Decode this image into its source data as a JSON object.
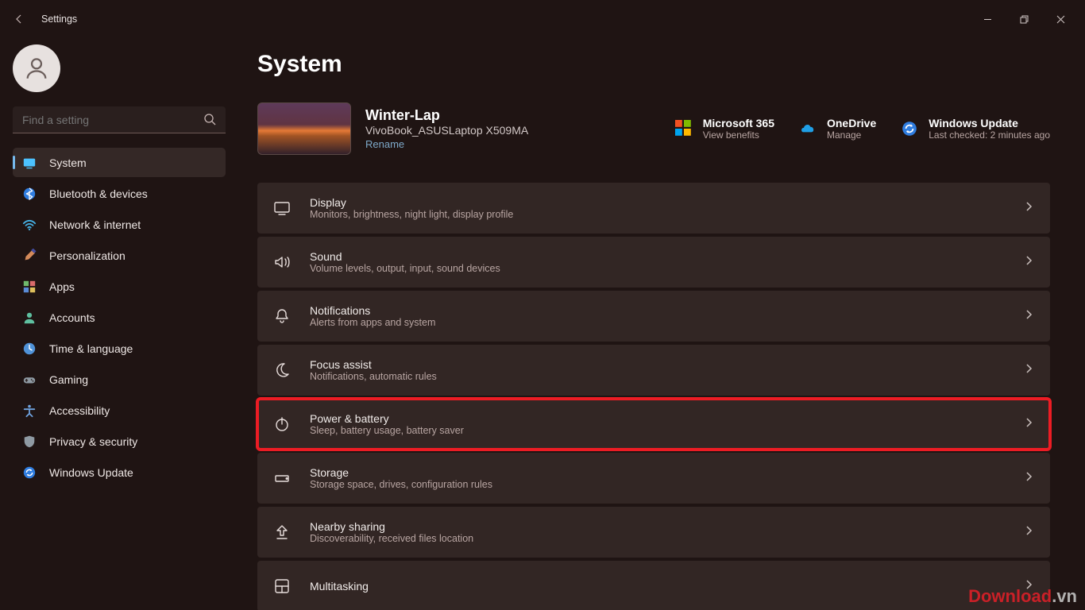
{
  "window": {
    "title": "Settings"
  },
  "user": {
    "name": "",
    "email": ""
  },
  "search": {
    "placeholder": "Find a setting"
  },
  "sidebar": {
    "items": [
      {
        "label": "System",
        "icon": "display"
      },
      {
        "label": "Bluetooth & devices",
        "icon": "bluetooth"
      },
      {
        "label": "Network & internet",
        "icon": "wifi"
      },
      {
        "label": "Personalization",
        "icon": "brush"
      },
      {
        "label": "Apps",
        "icon": "apps"
      },
      {
        "label": "Accounts",
        "icon": "person"
      },
      {
        "label": "Time & language",
        "icon": "clock"
      },
      {
        "label": "Gaming",
        "icon": "gamepad"
      },
      {
        "label": "Accessibility",
        "icon": "accessibility"
      },
      {
        "label": "Privacy & security",
        "icon": "shield"
      },
      {
        "label": "Windows Update",
        "icon": "update"
      }
    ],
    "selected_index": 0
  },
  "page": {
    "title": "System",
    "device": {
      "name": "Winter-Lap",
      "model": "VivoBook_ASUSLaptop X509MA",
      "rename": "Rename"
    },
    "cloud": [
      {
        "title": "Microsoft 365",
        "subtitle": "View benefits",
        "icon": "m365"
      },
      {
        "title": "OneDrive",
        "subtitle": "Manage",
        "icon": "onedrive"
      },
      {
        "title": "Windows Update",
        "subtitle": "Last checked: 2 minutes ago",
        "icon": "update"
      }
    ],
    "cards": [
      {
        "title": "Display",
        "subtitle": "Monitors, brightness, night light, display profile",
        "icon": "display"
      },
      {
        "title": "Sound",
        "subtitle": "Volume levels, output, input, sound devices",
        "icon": "sound"
      },
      {
        "title": "Notifications",
        "subtitle": "Alerts from apps and system",
        "icon": "bell"
      },
      {
        "title": "Focus assist",
        "subtitle": "Notifications, automatic rules",
        "icon": "moon"
      },
      {
        "title": "Power & battery",
        "subtitle": "Sleep, battery usage, battery saver",
        "icon": "power",
        "highlight": true
      },
      {
        "title": "Storage",
        "subtitle": "Storage space, drives, configuration rules",
        "icon": "storage"
      },
      {
        "title": "Nearby sharing",
        "subtitle": "Discoverability, received files location",
        "icon": "share"
      },
      {
        "title": "Multitasking",
        "subtitle": "",
        "icon": "multitask"
      }
    ]
  },
  "watermark": {
    "site": "Download",
    "tld": ".vn"
  }
}
